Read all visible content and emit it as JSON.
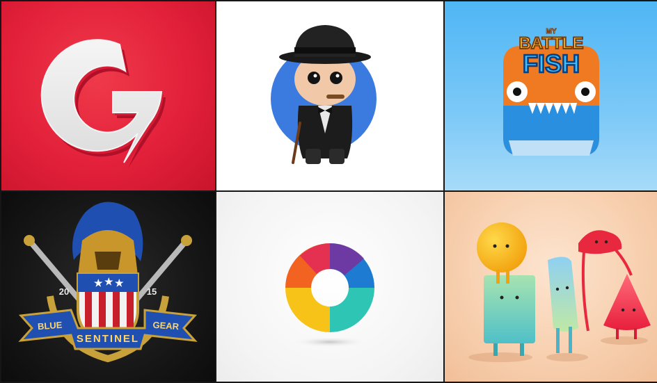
{
  "gallery": {
    "tiles": [
      {
        "id": "g-logo",
        "bg": "#e3203a"
      },
      {
        "id": "figure-character",
        "bg": "#ffffff"
      },
      {
        "id": "battle-fish-icon",
        "bg": "#5ab9f5",
        "logo_small": "MY",
        "logo_line1": "BATTLE",
        "logo_line2": "FISH"
      },
      {
        "id": "blue-sentinel-crest",
        "bg": "#141414",
        "year_left": "20",
        "year_right": "15",
        "ribbon_left": "BLUE",
        "ribbon_center": "SENTINEL",
        "ribbon_right": "GEAR"
      },
      {
        "id": "ring-logo",
        "bg": "#f4f4f4"
      },
      {
        "id": "3d-shapes-characters",
        "bg": "#f7cfae"
      }
    ]
  }
}
